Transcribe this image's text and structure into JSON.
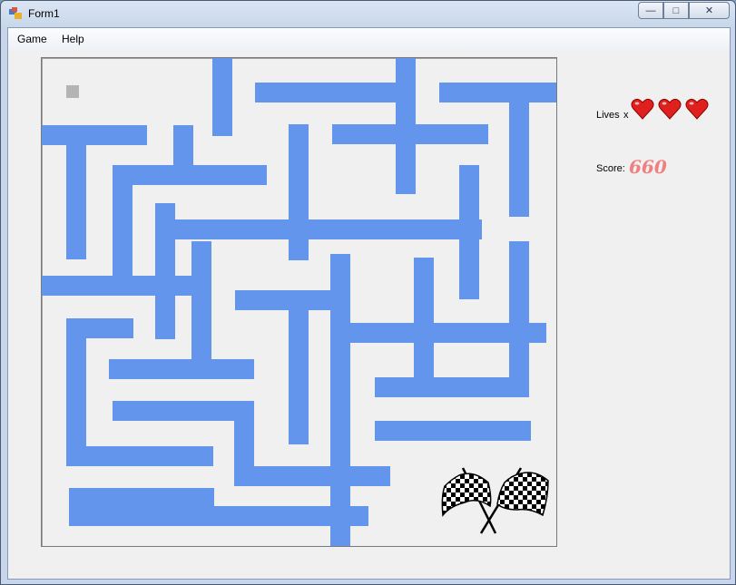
{
  "window": {
    "title": "Form1"
  },
  "title_buttons": {
    "minimize": "—",
    "maximize": "□",
    "close": "✕"
  },
  "menu": [
    "Game",
    "Help"
  ],
  "status": {
    "lives_label": "Lives",
    "lives_x": "x",
    "lives_count": 3,
    "score_label": "Score:",
    "score_value": "660"
  },
  "icons": {
    "player": "player-square",
    "finish": "checkered-flags-icon",
    "life": "heart-icon"
  },
  "colors": {
    "wall": "#6495ed",
    "heart": "#e0201c",
    "score": "#f08080",
    "background": "#f0f0f0",
    "player": "#b4b4b4"
  }
}
